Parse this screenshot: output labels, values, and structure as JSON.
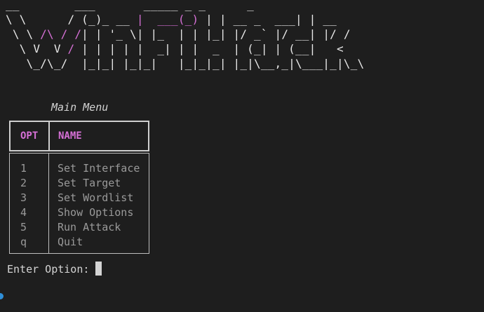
{
  "colors": {
    "background": "#1e1e1e",
    "banner_white": "#e8e8e8",
    "accent_magenta": "#d670d6",
    "table_text": "#9a9a9a",
    "prompt_text": "#d4d4d4",
    "activity_dot": "#2f8fd8"
  },
  "banner": {
    "lines": [
      [
        {
          "t": "__        ___       _____ _ _      _       ",
          "c": "w"
        }
      ],
      [
        {
          "t": "\\ \\      ",
          "c": "w"
        },
        {
          "t": "/ (_)_ __ ",
          "c": "w"
        },
        {
          "t": "|  ___(_) ",
          "c": "p"
        },
        {
          "t": "| | __ _  ___| | __",
          "c": "w"
        }
      ],
      [
        {
          "t": " \\ \\ ",
          "c": "w"
        },
        {
          "t": "/\\ / /",
          "c": "p"
        },
        {
          "t": "| | '_ \\| |_  | | |_| |/ _` |/ __| |/ /",
          "c": "w"
        }
      ],
      [
        {
          "t": "  \\ V  V ",
          "c": "w"
        },
        {
          "t": "/",
          "c": "p"
        },
        {
          "t": " | | | | |  _| | |  _  | (_| | (__|   <",
          "c": "w"
        }
      ],
      [
        {
          "t": "   \\_/\\_/  |_|_| |_|_|   |_|_|_| |_|\\__,_|\\___|_|\\_\\",
          "c": "w"
        }
      ]
    ]
  },
  "menu": {
    "title": "Main Menu",
    "headers": {
      "opt": "OPT",
      "name": "NAME"
    },
    "rows": [
      {
        "opt": "1",
        "name": "Set Interface"
      },
      {
        "opt": "2",
        "name": "Set Target"
      },
      {
        "opt": "3",
        "name": "Set Wordlist"
      },
      {
        "opt": "4",
        "name": "Show Options"
      },
      {
        "opt": "5",
        "name": "Run Attack"
      },
      {
        "opt": "q",
        "name": "Quit"
      }
    ]
  },
  "prompt": {
    "label": "Enter Option: "
  }
}
